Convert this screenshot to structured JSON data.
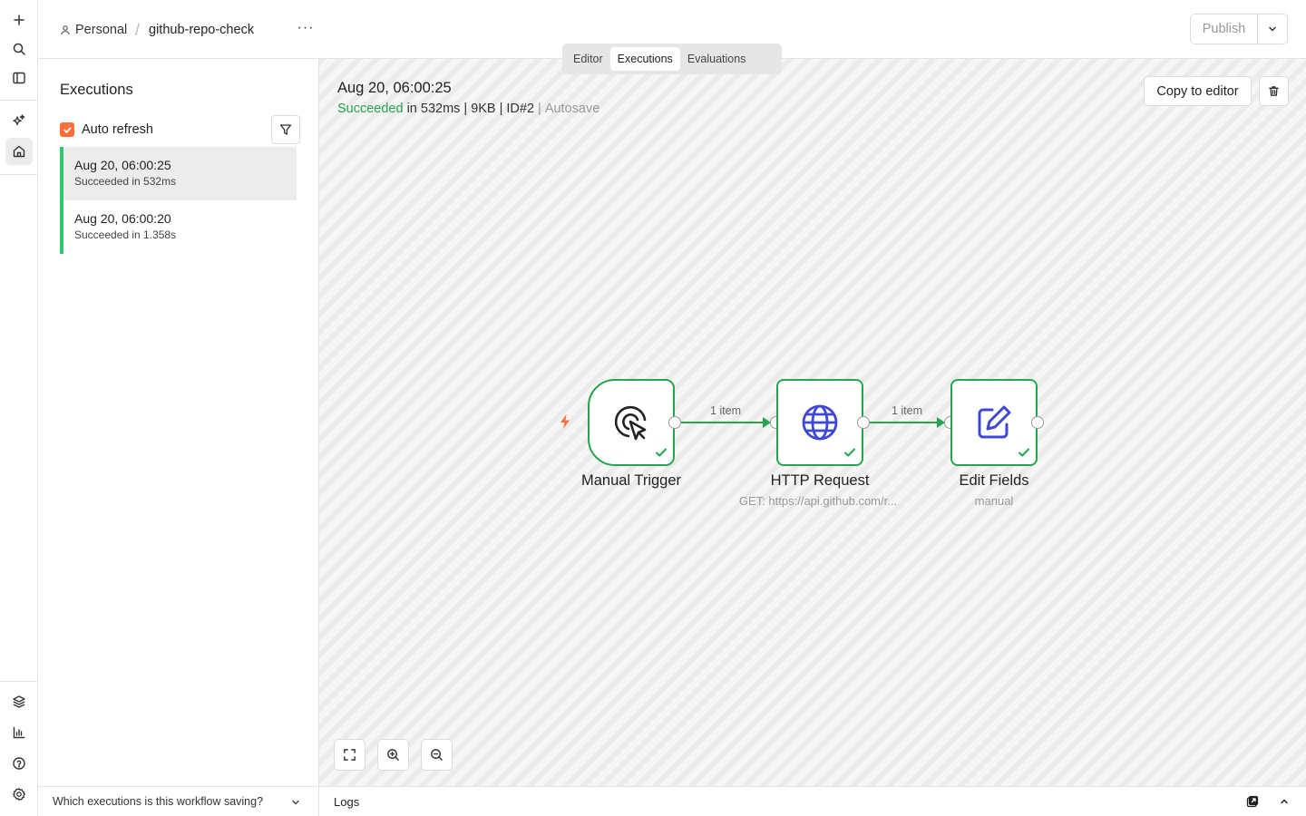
{
  "header": {
    "breadcrumb_project": "Personal",
    "breadcrumb_separator": "/",
    "workflow_name": "github-repo-check",
    "more_label": "···",
    "publish_label": "Publish"
  },
  "tabs": [
    {
      "label": "Editor",
      "active": false
    },
    {
      "label": "Executions",
      "active": true
    },
    {
      "label": "Evaluations",
      "active": false
    }
  ],
  "rail": {
    "top_icons": [
      "plus-icon",
      "search-icon",
      "sidebar-toggle-icon",
      "sparkles-icon",
      "home-icon"
    ],
    "bottom_icons": [
      "templates-icon",
      "insights-icon",
      "help-icon",
      "settings-icon"
    ]
  },
  "executions_panel": {
    "title": "Executions",
    "auto_refresh_label": "Auto refresh",
    "auto_refresh_checked": true,
    "items": [
      {
        "date": "Aug 20, 06:00:25",
        "status": "Succeeded in 532ms",
        "selected": true
      },
      {
        "date": "Aug 20, 06:00:20",
        "status": "Succeeded in 1.358s",
        "selected": false
      }
    ],
    "footer_label": "Which executions is this workflow saving?"
  },
  "execution_detail": {
    "date": "Aug 20, 06:00:25",
    "status_word": "Succeeded",
    "duration": "in 532ms",
    "sep1": "|",
    "size": "9KB",
    "sep2": "|",
    "id": "ID#2",
    "sep3": "|",
    "mode": "Autosave",
    "copy_button": "Copy to editor"
  },
  "workflow": {
    "nodes": [
      {
        "name": "Manual Trigger",
        "subtitle": "",
        "icon": "cursor-click-icon",
        "status": "success"
      },
      {
        "name": "HTTP Request",
        "subtitle": "GET: https://api.github.com/r...",
        "icon": "globe-icon",
        "status": "success"
      },
      {
        "name": "Edit Fields",
        "subtitle": "manual",
        "icon": "pen-square-icon",
        "status": "success"
      }
    ],
    "edges": [
      {
        "label": "1 item"
      },
      {
        "label": "1 item"
      }
    ]
  },
  "logs": {
    "label": "Logs"
  },
  "colors": {
    "success": "#23a64d",
    "accent": "#ff6d3a",
    "node_icon": "#3f48d6"
  }
}
